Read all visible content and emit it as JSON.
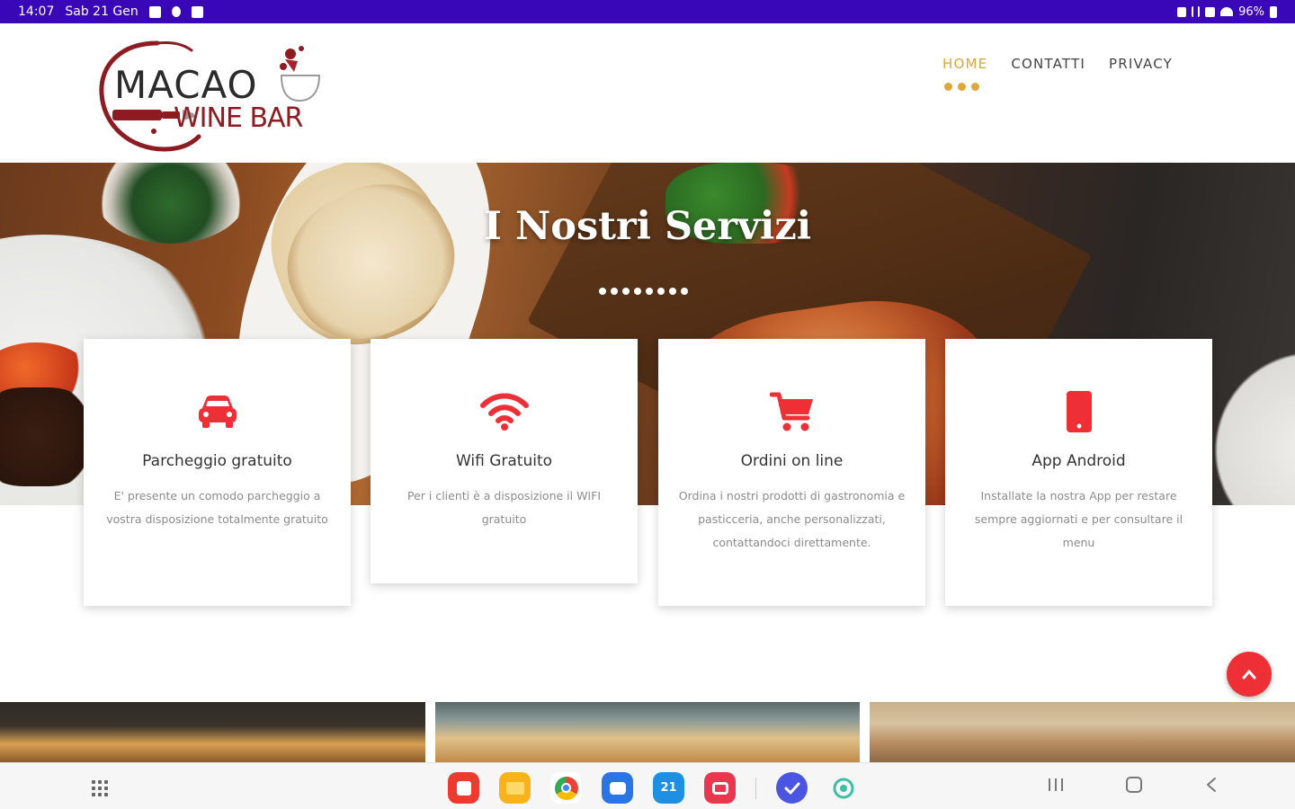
{
  "status_bar": {
    "time": "14:07",
    "date": "Sab 21 Gen",
    "battery": "96%"
  },
  "brand": {
    "line1": "MACAO",
    "line2": "WINE BAR"
  },
  "nav": {
    "items": [
      "HOME",
      "CONTATTI",
      "PRIVACY"
    ],
    "active": "HOME"
  },
  "hero": {
    "title": "I Nostri Servizi"
  },
  "services": [
    {
      "icon": "car-icon",
      "title": "Parcheggio gratuito",
      "description": "E' presente un comodo parcheggio a vostra disposizione totalmente gratuito"
    },
    {
      "icon": "wifi-icon",
      "title": "Wifi Gratuito",
      "description": "Per i clienti è a disposizione il WIFI gratuito"
    },
    {
      "icon": "cart-icon",
      "title": "Ordini on line",
      "description": "Ordina i nostri prodotti di gastronomia e pasticceria, anche personalizzati, contattandoci direttamente."
    },
    {
      "icon": "smartphone-icon",
      "title": "App Android",
      "description": "Installate la nostra App per restare sempre aggiornati e per consultare il menu"
    }
  ],
  "colors": {
    "accent": "#ef2f36",
    "nav_active": "#e0a63a",
    "status_bar": "#3a07b8",
    "brand_dark": "#2b2b2b",
    "brand_wine": "#8e1b22"
  },
  "android_dock": {
    "apps": [
      "notes-app-icon",
      "files-app-icon",
      "chrome-app-icon",
      "messages-app-icon",
      "calendar-app-icon",
      "screen-recorder-app-icon",
      "tasks-app-icon",
      "ai-app-icon"
    ],
    "calendar_day": "21"
  }
}
